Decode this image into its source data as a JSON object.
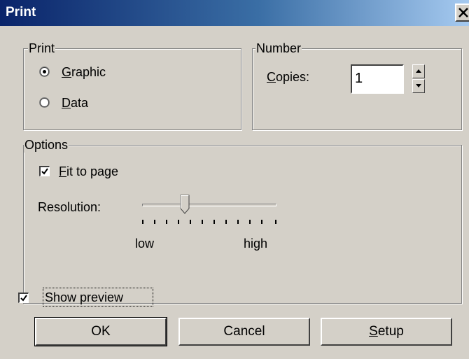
{
  "window": {
    "title": "Print",
    "close_glyph": "✕"
  },
  "print_group": {
    "legend": "Print",
    "options": [
      {
        "label": "Graphic",
        "accel": "G",
        "rest": "raphic",
        "selected": true
      },
      {
        "label": "Data",
        "accel": "D",
        "rest": "ata",
        "selected": false
      }
    ]
  },
  "number_group": {
    "legend": "Number",
    "copies_label_accel": "C",
    "copies_label_rest": "opies:",
    "copies_value": "1"
  },
  "options_group": {
    "legend": "Options",
    "fit_to_page": {
      "accel": "F",
      "rest": "it to page",
      "checked": true
    },
    "resolution_label": "Resolution:",
    "slider": {
      "min_label": "low",
      "max_label": "high",
      "position_fraction": 0.33,
      "tick_count": 12
    }
  },
  "show_preview": {
    "label": "Show preview",
    "checked": true
  },
  "buttons": {
    "ok": "OK",
    "cancel": "Cancel",
    "setup_accel": "S",
    "setup_rest": "etup"
  },
  "colors": {
    "title_bar_start": "#0a246a",
    "title_bar_end": "#a6caf0",
    "face": "#d4d0c8"
  }
}
